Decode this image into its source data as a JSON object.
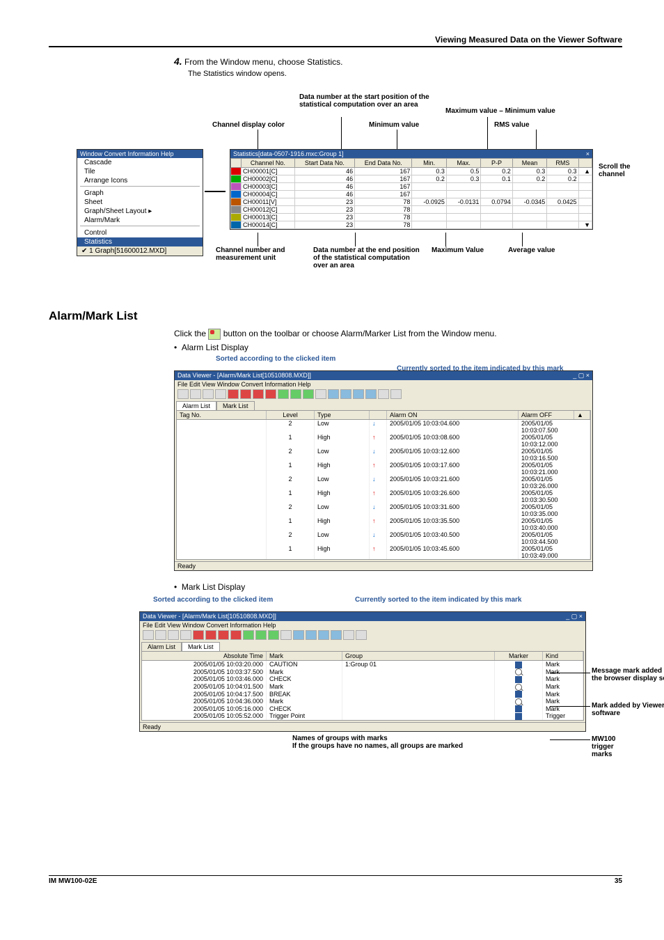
{
  "header": "Viewing Measured Data on the Viewer Software",
  "step": {
    "num": "4.",
    "text": "From the Window menu, choose Statistics.",
    "sub": "The Statistics window opens."
  },
  "fig1_labels": {
    "data_start": "Data number at the start position of the statistical computation over an area",
    "chan_color": "Channel display color",
    "min_val": "Minimum value",
    "max_minus_min": "Maximum value – Minimum value",
    "rms": "RMS value",
    "scroll": "Scroll the channel",
    "chan_num_unit": "Channel number and measurement unit",
    "data_end": "Data number at the end position of the statistical computation over an area",
    "max_val": "Maximum Value",
    "avg_val": "Average value"
  },
  "menu": {
    "bar": "Window  Convert  Information  Help",
    "items": [
      "Cascade",
      "Tile",
      "Arrange Icons"
    ],
    "items2": [
      "Graph",
      "Sheet",
      "Graph/Sheet Layout        ▸",
      "Alarm/Mark"
    ],
    "items3": [
      "Control",
      "Statistics"
    ],
    "foot": "✔ 1 Graph[51600012.MXD]"
  },
  "stats": {
    "title": "Statistics[data-0507-1916.mxc:Group 1]",
    "cols": [
      "",
      "Channel No.",
      "Start Data No.",
      "End Data No.",
      "Min.",
      "Max.",
      "P-P",
      "Mean",
      "RMS",
      ""
    ],
    "rows": [
      [
        "c1",
        "CH00001[C]",
        "46",
        "167",
        "0.3",
        "0.5",
        "0.2",
        "0.3",
        "0.3",
        "▲"
      ],
      [
        "c2",
        "CH00002[C]",
        "46",
        "167",
        "0.2",
        "0.3",
        "0.1",
        "0.2",
        "0.2",
        ""
      ],
      [
        "c3",
        "CH00003[C]",
        "46",
        "167",
        "",
        "",
        "",
        "",
        "",
        ""
      ],
      [
        "c4",
        "CH00004[C]",
        "46",
        "167",
        "",
        "",
        "",
        "",
        "",
        ""
      ],
      [
        "c5",
        "CH00011[V]",
        "23",
        "78",
        "-0.0925",
        "-0.0131",
        "0.0794",
        "-0.0345",
        "0.0425",
        ""
      ],
      [
        "c6",
        "CH00012[C]",
        "23",
        "78",
        "",
        "",
        "",
        "",
        "",
        ""
      ],
      [
        "c7",
        "CH00013[C]",
        "23",
        "78",
        "",
        "",
        "",
        "",
        "",
        ""
      ],
      [
        "c8",
        "CH00014[C]",
        "23",
        "78",
        "",
        "",
        "",
        "",
        "",
        "▼"
      ]
    ]
  },
  "alarm_heading": "Alarm/Mark List",
  "alarm_intro_a": "Click the ",
  "alarm_intro_b": " button on the toolbar or choose Alarm/Marker List from the Window menu.",
  "alarm_bullet": "Alarm List Display",
  "sorted_label": "Sorted according to the clicked item",
  "sorted_current": "Currently sorted to the item indicated by this mark",
  "alarmwin": {
    "title": "Data Viewer - [Alarm/Mark List[10510808.MXD]]",
    "menu": "File   Edit   View   Window   Convert   Information   Help",
    "tabs": [
      "Alarm List",
      "Mark List"
    ],
    "cols": [
      "Tag No.",
      "Level",
      "Type",
      "",
      "Alarm ON",
      "Alarm OFF",
      "▲"
    ],
    "rows": [
      [
        "",
        "2",
        "Low",
        "↓",
        "2005/01/05 10:03:04.600",
        "2005/01/05 10:03:07.500"
      ],
      [
        "",
        "1",
        "High",
        "↑",
        "2005/01/05 10:03:08.600",
        "2005/01/05 10:03:12.000"
      ],
      [
        "",
        "2",
        "Low",
        "↓",
        "2005/01/05 10:03:12.600",
        "2005/01/05 10:03:16.500"
      ],
      [
        "",
        "1",
        "High",
        "↑",
        "2005/01/05 10:03:17.600",
        "2005/01/05 10:03:21.000"
      ],
      [
        "",
        "2",
        "Low",
        "↓",
        "2005/01/05 10:03:21.600",
        "2005/01/05 10:03:26.000"
      ],
      [
        "",
        "1",
        "High",
        "↑",
        "2005/01/05 10:03:26.600",
        "2005/01/05 10:03:30.500"
      ],
      [
        "",
        "2",
        "Low",
        "↓",
        "2005/01/05 10:03:31.600",
        "2005/01/05 10:03:35.000"
      ],
      [
        "",
        "1",
        "High",
        "↑",
        "2005/01/05 10:03:35.500",
        "2005/01/05 10:03:40.000"
      ],
      [
        "",
        "2",
        "Low",
        "↓",
        "2005/01/05 10:03:40.500",
        "2005/01/05 10:03:44.500"
      ],
      [
        "",
        "1",
        "High",
        "↑",
        "2005/01/05 10:03:45.600",
        "2005/01/05 10:03:49.000"
      ]
    ],
    "status": "Ready"
  },
  "mark_bullet": "Mark List Display",
  "markwin": {
    "title": "Data Viewer - [Alarm/Mark List[10510808.MXD]]",
    "menu": "File   Edit   View   Window   Convert   Information   Help",
    "tabs": [
      "Alarm List",
      "Mark List"
    ],
    "cols": [
      "Absolute Time",
      "Mark",
      "Group",
      "Marker",
      "Kind"
    ],
    "rows": [
      [
        "2005/01/05 10:03:20.000",
        "CAUTION",
        "1:Group 01",
        "flag",
        "Mark"
      ],
      [
        "2005/01/05 10:03:37.500",
        "Mark",
        "",
        "mag",
        "Mark"
      ],
      [
        "2005/01/05 10:03:46.000",
        "CHECK",
        "",
        "flag",
        "Mark"
      ],
      [
        "2005/01/05 10:04:01.500",
        "Mark",
        "",
        "mag",
        "Mark"
      ],
      [
        "2005/01/05 10:04:17.500",
        "BREAK",
        "",
        "flag",
        "Mark"
      ],
      [
        "2005/01/05 10:04:36.000",
        "Mark",
        "",
        "mag",
        "Mark"
      ],
      [
        "2005/01/05 10:05:16.000",
        "CHECK",
        "",
        "flag",
        "Mark"
      ],
      [
        "2005/01/05 10:05:52.000",
        "Trigger Point",
        "",
        "flag",
        "Trigger"
      ]
    ],
    "status": "Ready"
  },
  "right_notes": {
    "msg": "Message mark added in the browser display screen",
    "added": "Mark added by Viewer software",
    "trig": "MW100 trigger marks"
  },
  "bottom_notes": {
    "a": "Names of groups with marks",
    "b": "If the groups have no names, all groups are marked"
  },
  "footer": {
    "left": "IM MW100-02E",
    "right": "35"
  }
}
